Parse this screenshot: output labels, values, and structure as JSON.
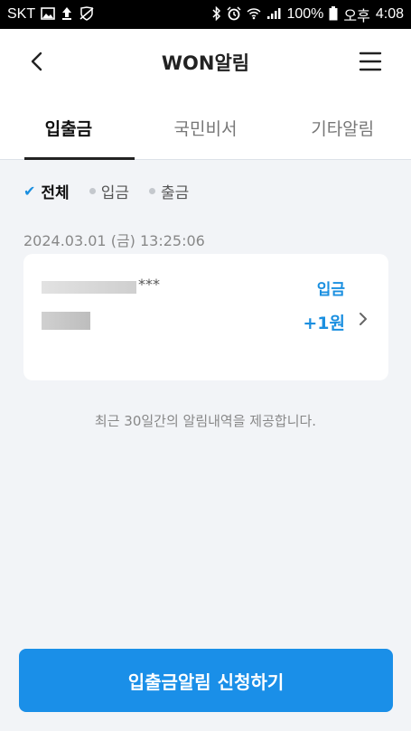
{
  "status_bar": {
    "carrier": "SKT",
    "battery": "100%",
    "ampm": "오후",
    "time": "4:08"
  },
  "header": {
    "title": "WON알림"
  },
  "tabs": [
    {
      "label": "입출금",
      "active": true
    },
    {
      "label": "국민비서",
      "active": false
    },
    {
      "label": "기타알림",
      "active": false
    }
  ],
  "filters": [
    {
      "label": "전체",
      "active": true
    },
    {
      "label": "입금",
      "active": false
    },
    {
      "label": "출금",
      "active": false
    }
  ],
  "notification": {
    "datetime": "2024.03.01 (금) 13:25:06",
    "account_suffix": "***",
    "type": "입금",
    "amount": "+1원"
  },
  "footnote": "최근 30일간의 알림내역을 제공합니다.",
  "apply_button": "입출금알림 신청하기",
  "colors": {
    "accent": "#1a8fe8",
    "background": "#f2f4f7"
  }
}
